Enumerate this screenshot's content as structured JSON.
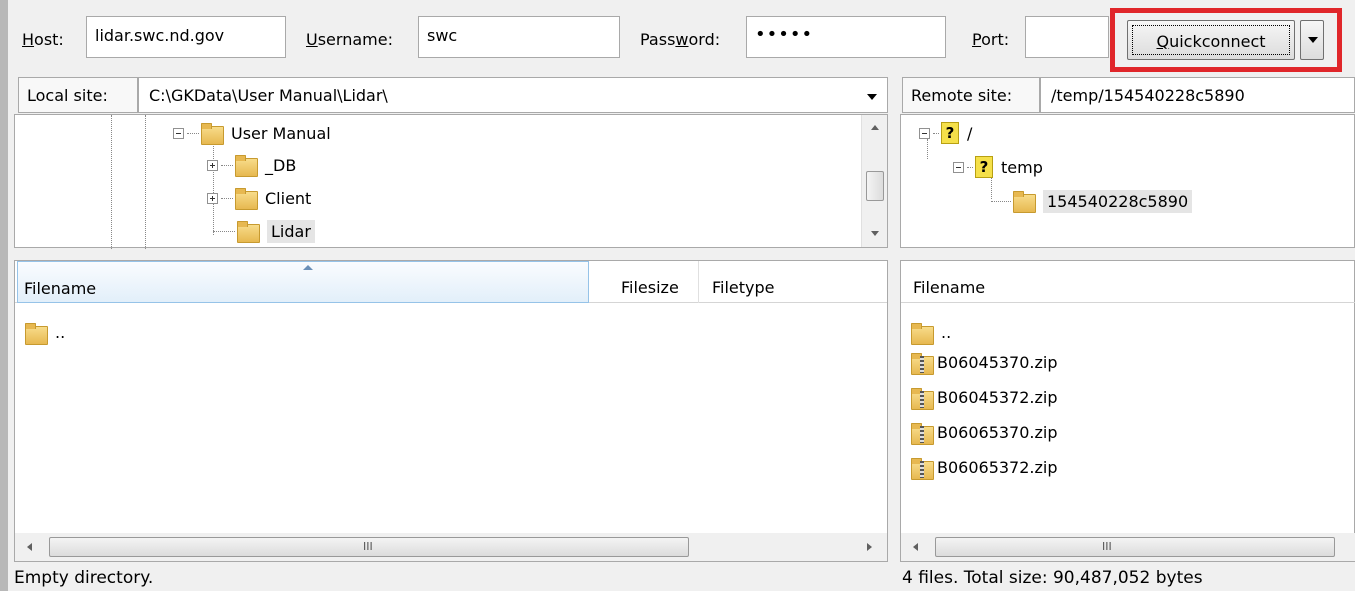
{
  "quickconnect": {
    "host_label_underlined": "H",
    "host_label_rest": "ost:",
    "host_value": "lidar.swc.nd.gov",
    "username_label_underlined": "U",
    "username_label_rest": "sername:",
    "username_value": "swc",
    "password_label_pre": "Pass",
    "password_label_underlined": "w",
    "password_label_rest": "ord:",
    "password_value": "•••••",
    "port_label_underlined": "P",
    "port_label_rest": "ort:",
    "port_value": "",
    "button_underlined": "Q",
    "button_rest": "uickconnect"
  },
  "local": {
    "site_label": "Local site:",
    "site_path": "C:\\GKData\\User Manual\\Lidar\\",
    "tree": [
      {
        "label": "User Manual"
      },
      {
        "label": "_DB"
      },
      {
        "label": "Client"
      },
      {
        "label": "Lidar"
      }
    ],
    "columns": {
      "filename": "Filename",
      "filesize": "Filesize",
      "filetype": "Filetype"
    },
    "files": [
      {
        "name": ".."
      }
    ],
    "scroll_grip": "III",
    "status": "Empty directory."
  },
  "remote": {
    "site_label": "Remote site:",
    "site_path": "/temp/154540228c5890",
    "tree": [
      {
        "label": "/"
      },
      {
        "label": "temp"
      },
      {
        "label": "154540228c5890"
      }
    ],
    "columns": {
      "filename": "Filename"
    },
    "files": [
      {
        "name": ".."
      },
      {
        "name": "B06045370.zip"
      },
      {
        "name": "B06045372.zip"
      },
      {
        "name": "B06065370.zip"
      },
      {
        "name": "B06065372.zip"
      }
    ],
    "scroll_grip": "III",
    "status": "4 files. Total size: 90,487,052 bytes"
  },
  "colors": {
    "highlight": "#e0262a",
    "selection": "#e5e5e5",
    "sorted_header": "#96c3e8"
  }
}
